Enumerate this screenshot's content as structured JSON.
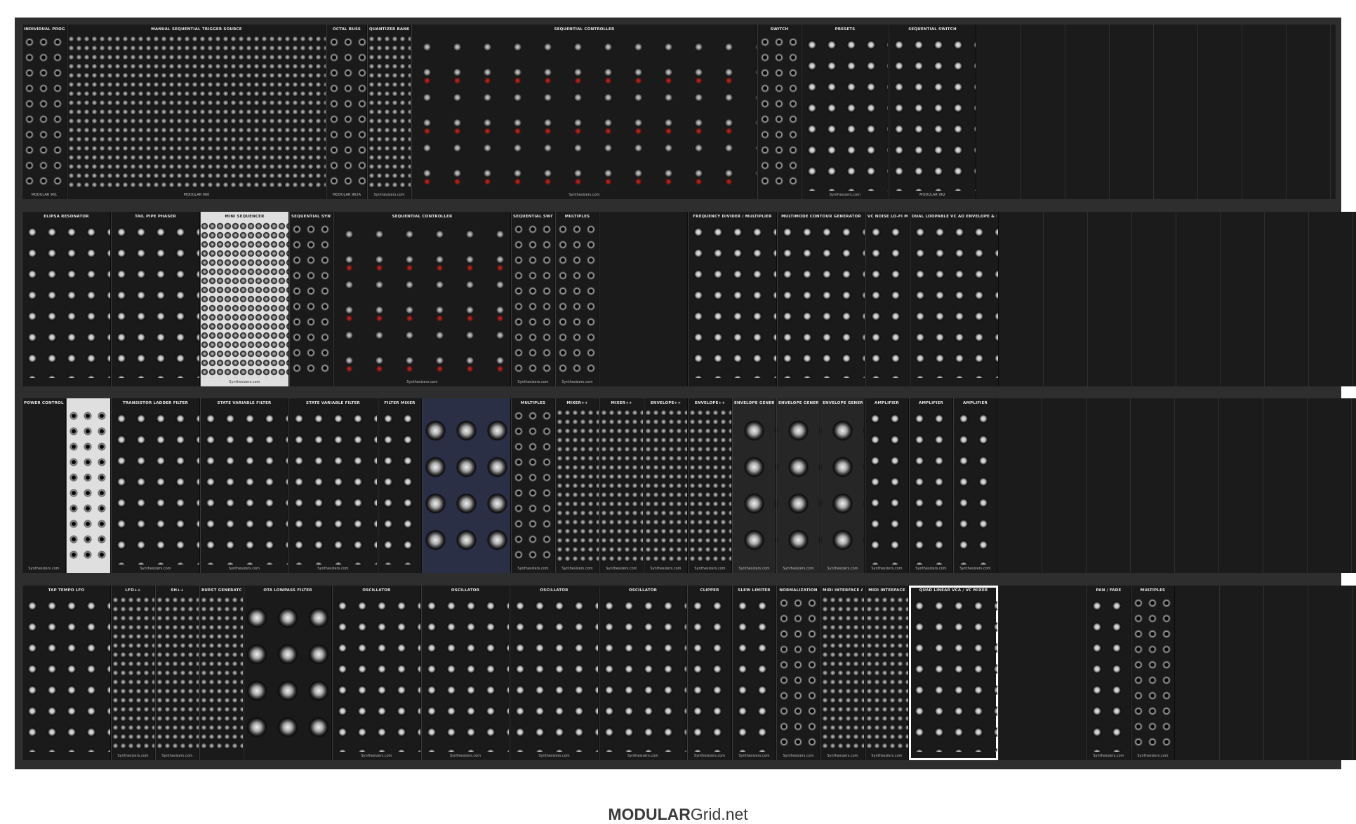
{
  "footer": {
    "brand_bold": "MODULAR",
    "brand_rest": "Grid.net"
  },
  "rows": [
    {
      "modules": [
        {
          "w": 64,
          "title": "Individual Programmer",
          "brand": "MODULAR 961",
          "tex": "jack"
        },
        {
          "w": 370,
          "title": "Manual Sequential Trigger Source",
          "brand": "MODULAR 960",
          "tex": "small",
          "light": false
        },
        {
          "w": 58,
          "title": "Octal Buss",
          "brand": "MODULAR 962A",
          "tex": "jack"
        },
        {
          "w": 63,
          "title": "Quantizer Bank",
          "brand": "Synthesizers.com",
          "tex": "small"
        },
        {
          "w": 493,
          "title": "Sequential Controller",
          "brand": "Synthesizers.com",
          "tex": "seq"
        },
        {
          "w": 63,
          "title": "Switch",
          "brand": "",
          "tex": "jack"
        },
        {
          "w": 124,
          "title": "Presets",
          "brand": "Synthesizers.com",
          "tex": "knob"
        },
        {
          "w": 125,
          "title": "Sequential Switch",
          "brand": "MODULAR 962",
          "tex": "knob"
        }
      ],
      "empty": 512
    },
    {
      "modules": [
        {
          "w": 127,
          "title": "Elipsa Resonator",
          "brand": "",
          "tex": "knob"
        },
        {
          "w": 127,
          "title": "Tail Pipe Phaser",
          "brand": "",
          "tex": "knob"
        },
        {
          "w": 127,
          "title": "Mini Sequencer",
          "brand": "Synthesizers.com",
          "tex": "small",
          "light": true
        },
        {
          "w": 63,
          "title": "Sequential Synth",
          "brand": "",
          "tex": "jack"
        },
        {
          "w": 253,
          "title": "Sequential Controller",
          "brand": "Synthesizers.com",
          "tex": "seq"
        },
        {
          "w": 63,
          "title": "Sequential Switch",
          "brand": "Synthesizers.com",
          "tex": "jack"
        },
        {
          "w": 63,
          "title": "Multiples",
          "brand": "Synthesizers.com",
          "tex": "jack"
        },
        {
          "w": 126,
          "title": "",
          "brand": "",
          "tex": "none",
          "blank": true
        },
        {
          "w": 127,
          "title": "Frequency Divider / Multiplier",
          "brand": "",
          "tex": "knob"
        },
        {
          "w": 126,
          "title": "Multimode Contour Generator",
          "brand": "",
          "tex": "knob"
        },
        {
          "w": 63,
          "title": "VC Noise Lo-Fi Machine",
          "brand": "",
          "tex": "knob"
        },
        {
          "w": 127,
          "title": "Dual Loopable VC AD Envelope & More",
          "brand": "",
          "tex": "knob"
        }
      ],
      "empty": 512
    },
    {
      "modules": [
        {
          "w": 63,
          "title": "Power Control + Interface",
          "brand": "Synthesizers.com",
          "tex": "none"
        },
        {
          "w": 64,
          "title": "",
          "brand": "",
          "tex": "jack",
          "light": true
        },
        {
          "w": 127,
          "title": "Transistor Ladder Filter",
          "brand": "Synthesizers.com",
          "tex": "knob"
        },
        {
          "w": 126,
          "title": "State Variable Filter",
          "brand": "Synthesizers.com",
          "tex": "knob"
        },
        {
          "w": 127,
          "title": "State Variable Filter",
          "brand": "Synthesizers.com",
          "tex": "knob"
        },
        {
          "w": 63,
          "title": "Filter Mixer",
          "brand": "",
          "tex": "knob"
        },
        {
          "w": 127,
          "title": "",
          "brand": "",
          "tex": "big",
          "blue": true
        },
        {
          "w": 63,
          "title": "Multiples",
          "brand": "Synthesizers.com",
          "tex": "jack"
        },
        {
          "w": 63,
          "title": "Mixer++",
          "brand": "Synthesizers.com",
          "tex": "small"
        },
        {
          "w": 63,
          "title": "Mixer++",
          "brand": "Synthesizers.com",
          "tex": "small"
        },
        {
          "w": 63,
          "title": "Envelope++",
          "brand": "Synthesizers.com",
          "tex": "small"
        },
        {
          "w": 63,
          "title": "Envelope++",
          "brand": "Synthesizers.com",
          "tex": "small"
        },
        {
          "w": 63,
          "title": "Envelope Generator",
          "brand": "Synthesizers.com",
          "tex": "big",
          "panel2": true
        },
        {
          "w": 63,
          "title": "Envelope Generator",
          "brand": "Synthesizers.com",
          "tex": "big",
          "panel2": true
        },
        {
          "w": 63,
          "title": "Envelope Generator",
          "brand": "Synthesizers.com",
          "tex": "big",
          "panel2": true
        },
        {
          "w": 63,
          "title": "Amplifier",
          "brand": "Synthesizers.com",
          "tex": "knob"
        },
        {
          "w": 63,
          "title": "Amplifier",
          "brand": "Synthesizers.com",
          "tex": "knob"
        },
        {
          "w": 63,
          "title": "Amplifier",
          "brand": "Synthesizers.com",
          "tex": "knob"
        }
      ],
      "empty": 512
    },
    {
      "modules": [
        {
          "w": 127,
          "title": "Tap Tempo LFO",
          "brand": "",
          "tex": "knob"
        },
        {
          "w": 63,
          "title": "LFO++",
          "brand": "Synthesizers.com",
          "tex": "small"
        },
        {
          "w": 63,
          "title": "SH++",
          "brand": "Synthesizers.com",
          "tex": "small"
        },
        {
          "w": 63,
          "title": "Burst Generator",
          "brand": "",
          "tex": "small"
        },
        {
          "w": 126,
          "title": "OTA Lowpass Filter",
          "brand": "",
          "tex": "big"
        },
        {
          "w": 127,
          "title": "Oscillator",
          "brand": "Synthesizers.com",
          "tex": "knob"
        },
        {
          "w": 126,
          "title": "Oscillator",
          "brand": "Synthesizers.com",
          "tex": "knob"
        },
        {
          "w": 127,
          "title": "Oscillator",
          "brand": "Synthesizers.com",
          "tex": "knob"
        },
        {
          "w": 126,
          "title": "Oscillator",
          "brand": "Synthesizers.com",
          "tex": "knob"
        },
        {
          "w": 64,
          "title": "Clipper",
          "brand": "Synthesizers.com",
          "tex": "knob"
        },
        {
          "w": 63,
          "title": "Slew Limiter",
          "brand": "Synthesizers.com",
          "tex": "knob"
        },
        {
          "w": 63,
          "title": "Normalization",
          "brand": "Synthesizers.com",
          "tex": "jack"
        },
        {
          "w": 63,
          "title": "MIDI Interface A/D",
          "brand": "Synthesizers.com",
          "tex": "small"
        },
        {
          "w": 63,
          "title": "MIDI Interface",
          "brand": "Synthesizers.com",
          "tex": "small"
        },
        {
          "w": 127,
          "title": "Quad Linear VCA / VC Mixer",
          "brand": "",
          "tex": "knob",
          "sel": true
        },
        {
          "w": 126,
          "title": "",
          "brand": "",
          "tex": "none",
          "blank": true
        },
        {
          "w": 63,
          "title": "Pan / Fade",
          "brand": "Synthesizers.com",
          "tex": "knob"
        },
        {
          "w": 63,
          "title": "Multiples",
          "brand": "Synthesizers.com",
          "tex": "jack"
        }
      ],
      "empty": 259
    }
  ]
}
